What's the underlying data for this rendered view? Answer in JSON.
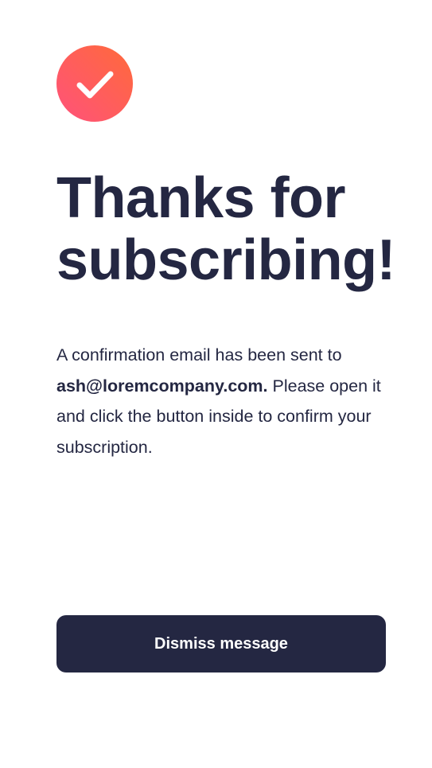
{
  "icon": {
    "name": "checkmark-icon",
    "gradient_start": "#ff6a3a",
    "gradient_end": "#ff527b"
  },
  "title": "Thanks for subscribing!",
  "message": {
    "before_email": "A confirmation email has been sent to ",
    "email": "ash@loremcompany.com.",
    "after_email": " Please open it and click the button inside to confirm your subscription."
  },
  "dismiss_label": "Dismiss message",
  "colors": {
    "text": "#242742",
    "button_bg": "#242742",
    "button_text": "#ffffff"
  }
}
